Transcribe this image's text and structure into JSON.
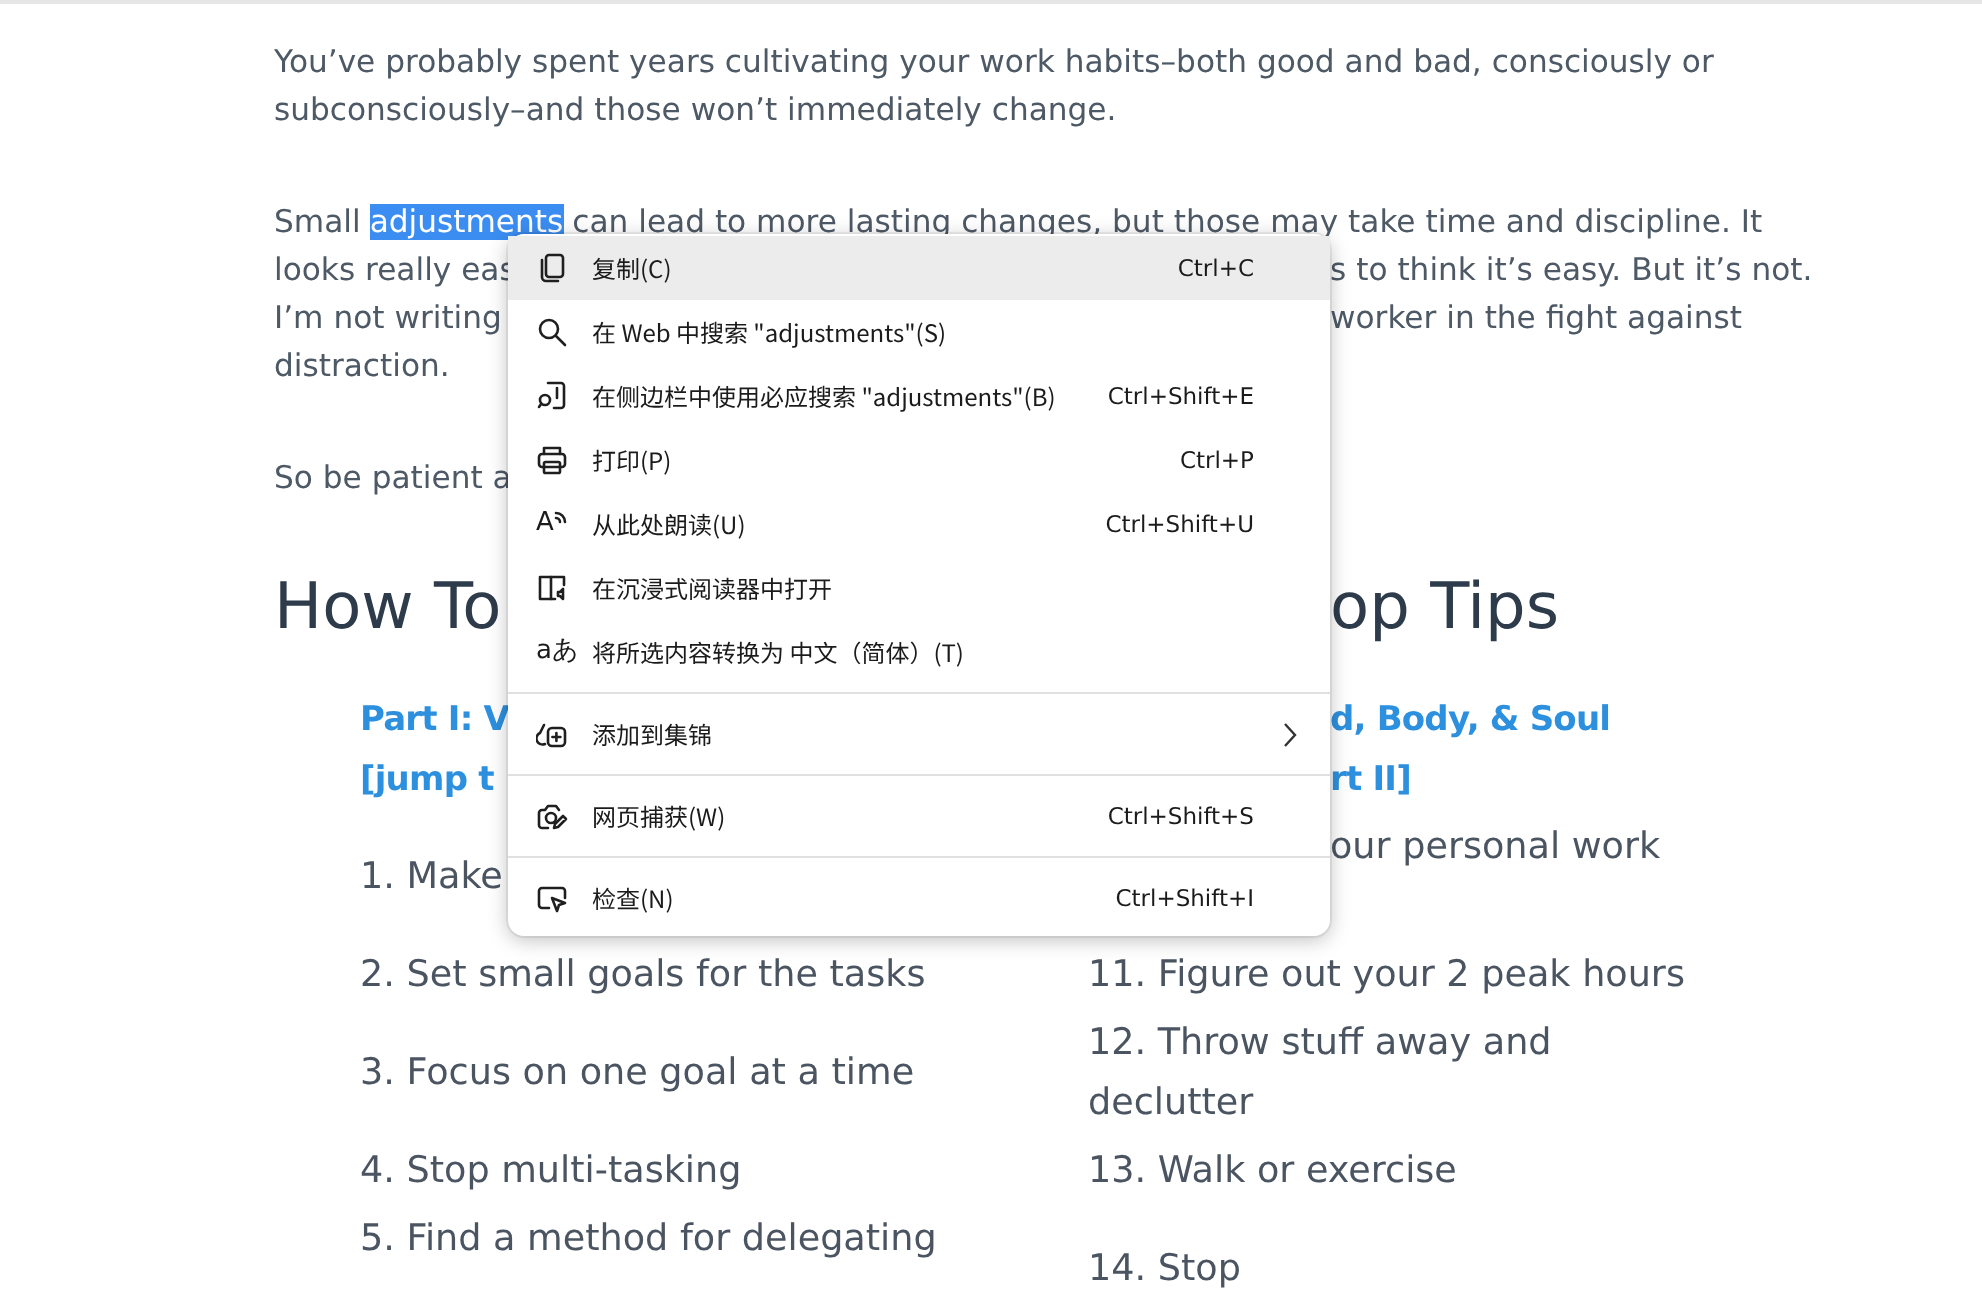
{
  "article": {
    "intro_paragraph": "You’ve probably spent years cultivating your work habits–both good and bad, consciously or subconsciously–and those won’t immediately change.",
    "paragraph_lines": [
      {
        "kind": "selection",
        "parts": [
          {
            "text": "Small",
            "selected": false
          },
          {
            "text": "adjustments",
            "selected": true
          },
          {
            "text": "can lead to more lasting changes, but those may take time and discipline. It",
            "selected": false
          }
        ]
      },
      {
        "kind": "split",
        "left": "looks really eas",
        "right": "s to think it’s easy. But it’s not."
      },
      {
        "kind": "split",
        "left": "I’m not writing",
        "right": "worker in the fight against"
      },
      {
        "kind": "split",
        "left": "distraction."
      }
    ],
    "closing_line": {
      "left": "So be patient a"
    },
    "heading": {
      "left": "How To",
      "right": "op Tips"
    },
    "part_heading": {
      "left": "Part I: V",
      "right": "d, Body, & Soul"
    },
    "jump_link": {
      "left": "[jump t",
      "right": "rt II]"
    },
    "tips": [
      {
        "kind": "split",
        "left": "1. Make",
        "right": "our personal work"
      },
      {
        "kind": "full",
        "left": "2. Set small goals for the tasks",
        "right": "11. Figure out your 2 peak hours"
      },
      {
        "kind": "full",
        "left": "3. Focus on one goal at a time",
        "right": "12. Throw stuff away and declutter"
      },
      {
        "kind": "full",
        "left": "4. Stop multi-tasking",
        "right": "13. Walk or exercise"
      },
      {
        "kind": "full",
        "left": "5. Find a method for delegating",
        "right": "14. Stop"
      }
    ]
  },
  "context_menu": {
    "items": [
      {
        "kind": "item",
        "label": "复制(C)",
        "shortcut": "Ctrl+C",
        "selected": true,
        "submenu": false
      },
      {
        "kind": "item",
        "label": "在 Web 中搜索 \"adjustments\"(S)",
        "selected": false,
        "submenu": false
      },
      {
        "kind": "item",
        "label": "在侧边栏中使用必应搜索 \"adjustments\"(B)",
        "shortcut": "Ctrl+Shift+E",
        "selected": false,
        "submenu": false
      },
      {
        "kind": "item",
        "label": "打印(P)",
        "shortcut": "Ctrl+P",
        "selected": false,
        "submenu": false
      },
      {
        "kind": "item",
        "glyph": "A",
        "label": "从此处朗读(U)",
        "shortcut": "Ctrl+Shift+U",
        "selected": false,
        "submenu": false
      },
      {
        "kind": "item",
        "label": "在沉浸式阅读器中打开",
        "selected": false,
        "submenu": false
      },
      {
        "kind": "item",
        "glyph": "aあ",
        "label": "将所选内容转换为 中文（简体）(T)",
        "selected": false,
        "submenu": false
      },
      {
        "kind": "separator"
      },
      {
        "kind": "item",
        "label": "添加到集锦",
        "selected": false,
        "submenu": true
      },
      {
        "kind": "separator"
      },
      {
        "kind": "item",
        "label": "网页捕获(W)",
        "shortcut": "Ctrl+Shift+S",
        "selected": false,
        "submenu": false
      },
      {
        "kind": "separator"
      },
      {
        "kind": "item",
        "label": "检查(N)",
        "shortcut": "Ctrl+Shift+I",
        "selected": false,
        "submenu": false
      }
    ]
  }
}
